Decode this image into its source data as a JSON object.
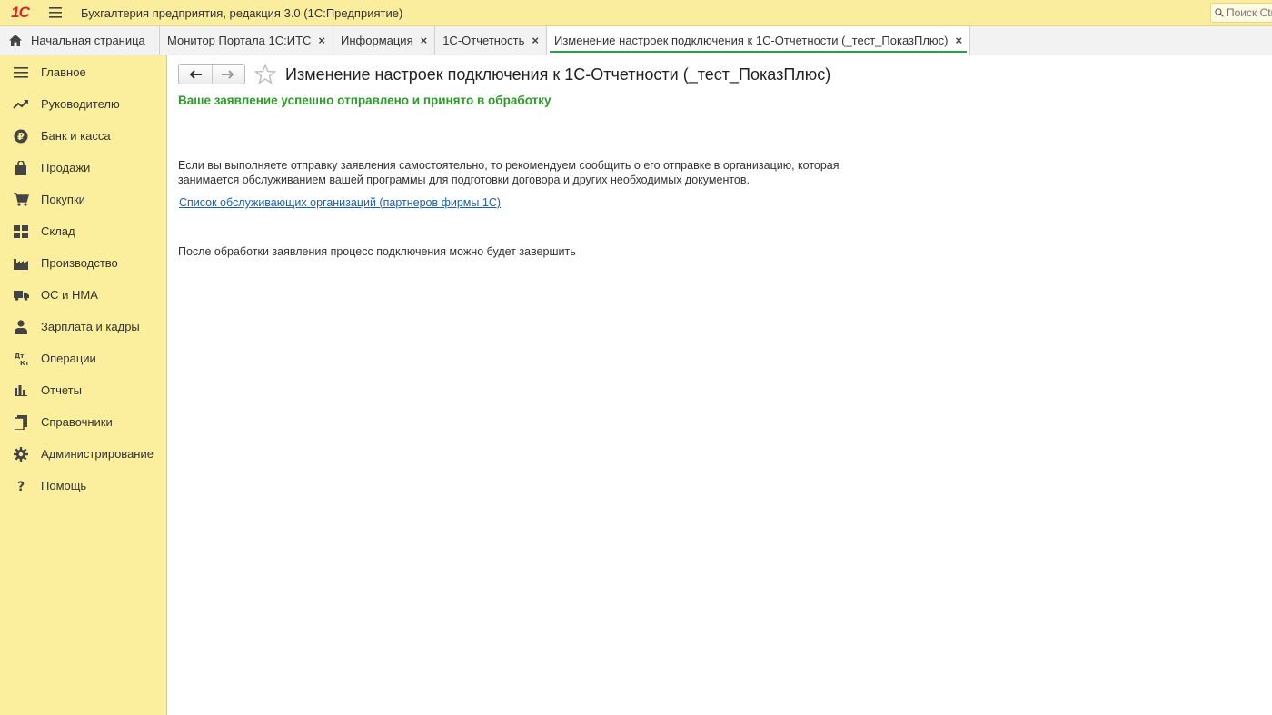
{
  "app": {
    "logo_text": "1С",
    "title": "Бухгалтерия предприятия, редакция 3.0  (1С:Предприятие)",
    "search_placeholder": "Поиск Ctrl+Shift+F"
  },
  "tabs": [
    {
      "label": "Начальная страница",
      "icon": "home-icon",
      "closable": false
    },
    {
      "label": "Монитор Портала 1С:ИТС",
      "closable": true
    },
    {
      "label": "Информация",
      "closable": true
    },
    {
      "label": "1С-Отчетность",
      "closable": true
    },
    {
      "label": "Изменение настроек подключения к 1С-Отчетности (_тест_ПоказПлюс)",
      "closable": true,
      "active": true
    }
  ],
  "tab_close_glyph": "×",
  "sidebar": {
    "items": [
      {
        "label": "Главное",
        "icon": "menu-lines-icon"
      },
      {
        "label": "Руководителю",
        "icon": "trend-up-icon"
      },
      {
        "label": "Банк и касса",
        "icon": "ruble-coin-icon"
      },
      {
        "label": "Продажи",
        "icon": "shopping-bag-icon"
      },
      {
        "label": "Покупки",
        "icon": "cart-icon"
      },
      {
        "label": "Склад",
        "icon": "warehouse-grid-icon"
      },
      {
        "label": "Производство",
        "icon": "factory-icon"
      },
      {
        "label": "ОС и НМА",
        "icon": "truck-icon"
      },
      {
        "label": "Зарплата и кадры",
        "icon": "person-icon"
      },
      {
        "label": "Операции",
        "icon": "dt-kt-icon"
      },
      {
        "label": "Отчеты",
        "icon": "bar-chart-icon"
      },
      {
        "label": "Справочники",
        "icon": "books-icon"
      },
      {
        "label": "Администрирование",
        "icon": "gear-icon"
      },
      {
        "label": "Помощь",
        "icon": "question-icon"
      }
    ]
  },
  "content": {
    "title": "Изменение настроек подключения к 1С-Отчетности (_тест_ПоказПлюс)",
    "success_message": "Ваше заявление успешно отправлено и принято в обработку",
    "info_text": "Если вы выполняете отправку заявления самостоятельно, то рекомендуем сообщить о его отправке в организацию, которая занимается обслуживанием вашей программы для подготовки договора и других необходимых документов.",
    "partners_link": "Список обслуживающих организаций (партнеров фирмы 1С)",
    "after_text": "После обработки заявления процесс подключения можно будет завершить"
  },
  "colors": {
    "titlebar_bg": "#fbed9e",
    "sidebar_bg": "#fbef9d",
    "success_green": "#2f9a2a",
    "link_blue": "#1d5fa8",
    "active_tab_underline": "#2e9e45",
    "logo_red": "#d8262b"
  }
}
